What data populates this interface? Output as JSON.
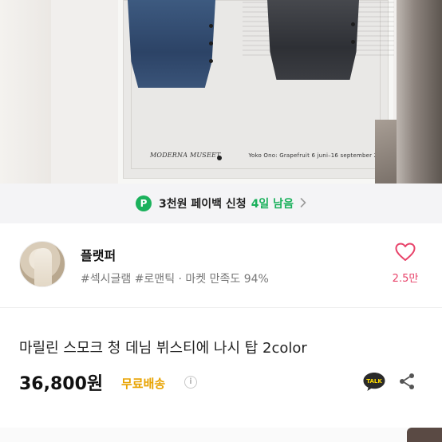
{
  "photo": {
    "caption_signature": "MODERNA MUSEET",
    "caption_text": "Yoko Ono: Grapefruit  6 juni–16 september 2012"
  },
  "payback": {
    "icon_letter": "P",
    "label": "3천원 페이백 신청",
    "days_left": "4일 남음",
    "accent_color": "#1bb15c"
  },
  "shop": {
    "name": "플랫퍼",
    "tags": "#섹시글램 #로맨틱 · 마켓 만족도 94%",
    "like_count": "2.5만",
    "like_color": "#e8436a"
  },
  "product": {
    "title": "마릴린 스모크 청 데님 뷔스티에 나시 탑 2color",
    "price": "36,800원",
    "shipping_label": "무료배송",
    "shipping_color": "#e8a300",
    "info_icon": "i",
    "talk_label": "TALK"
  },
  "icons": {
    "payback": "payback-p-icon",
    "chevron": "chevron-right-icon",
    "like": "heart-icon",
    "info": "info-icon",
    "talk": "kakao-talk-icon",
    "share": "share-icon"
  }
}
